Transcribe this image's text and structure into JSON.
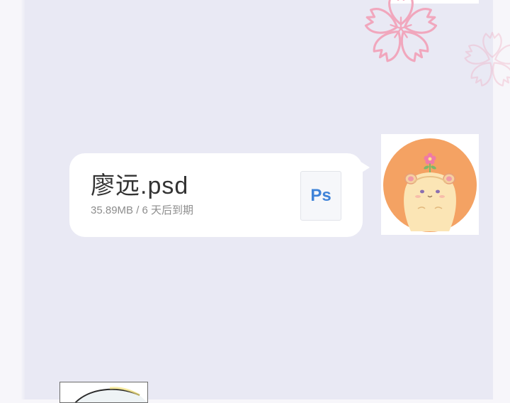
{
  "message": {
    "file_name": "廖远.psd",
    "file_meta": "35.89MB / 6 天后到期",
    "file_type_label": "Ps",
    "file_icon": "photoshop-file-icon"
  },
  "sender": {
    "avatar_icon": "hamster-avatar"
  },
  "decorations": {
    "background_icon": "sakura-flower-icon"
  },
  "colors": {
    "chat_background": "#e9e9f4",
    "bubble": "#ffffff",
    "ps_accent": "#3f83d8",
    "avatar_circle": "#f4a263",
    "sakura": "#f1a7bd"
  }
}
